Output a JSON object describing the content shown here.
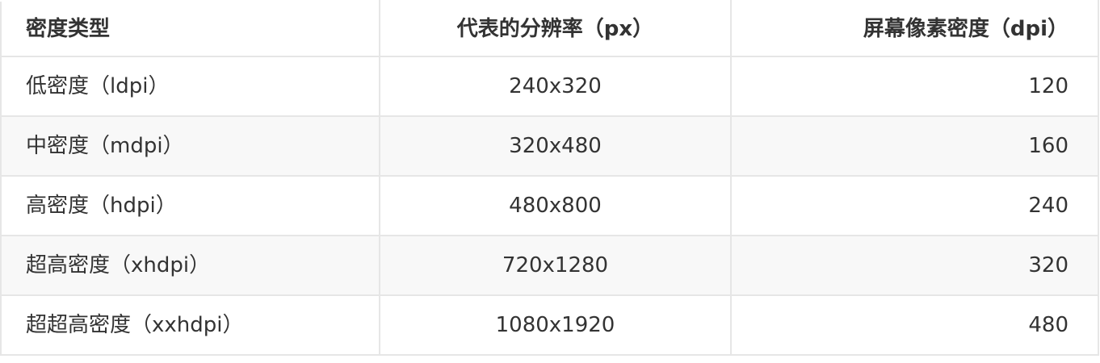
{
  "table": {
    "headers": [
      "密度类型",
      "代表的分辨率（px）",
      "屏幕像素密度（dpi）"
    ],
    "rows": [
      [
        "低密度（ldpi）",
        "240x320",
        "120"
      ],
      [
        "中密度（mdpi）",
        "320x480",
        "160"
      ],
      [
        "高密度（hdpi）",
        "480x800",
        "240"
      ],
      [
        "超高密度（xhdpi）",
        "720x1280",
        "320"
      ],
      [
        "超超高密度（xxhdpi）",
        "1080x1920",
        "480"
      ]
    ]
  }
}
